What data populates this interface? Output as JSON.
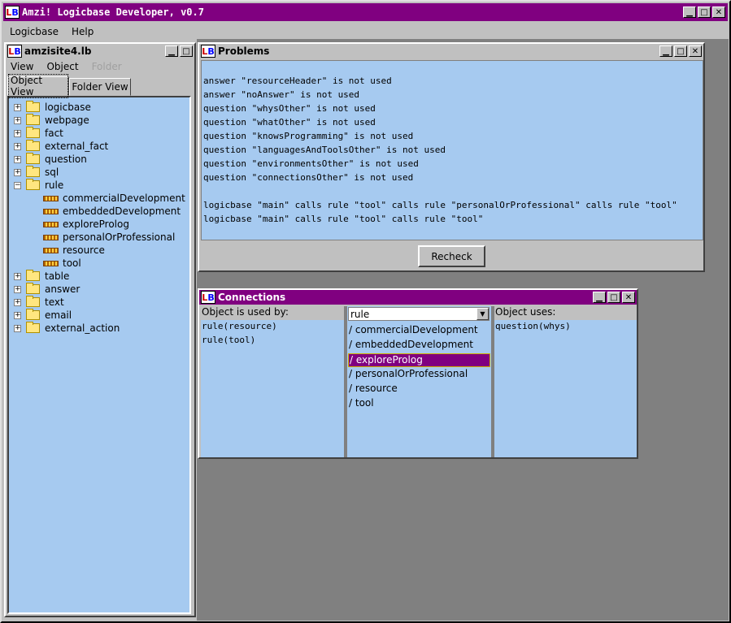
{
  "app": {
    "title": "Amzi! Logicbase Developer, v0.7",
    "menu": [
      "Logicbase",
      "Help"
    ]
  },
  "tree_window": {
    "title": "amzisite4.lb",
    "menu": [
      "View",
      "Object",
      "Folder"
    ],
    "tabs": [
      "Object View",
      "Folder View"
    ],
    "items": [
      {
        "label": "logicbase",
        "kind": "folder"
      },
      {
        "label": "webpage",
        "kind": "folder"
      },
      {
        "label": "fact",
        "kind": "folder"
      },
      {
        "label": "external_fact",
        "kind": "folder"
      },
      {
        "label": "question",
        "kind": "folder"
      },
      {
        "label": "sql",
        "kind": "folder"
      },
      {
        "label": "rule",
        "kind": "folder-open"
      },
      {
        "label": "commercialDevelopment",
        "kind": "rule"
      },
      {
        "label": "embeddedDevelopment",
        "kind": "rule"
      },
      {
        "label": "exploreProlog",
        "kind": "rule"
      },
      {
        "label": "personalOrProfessional",
        "kind": "rule"
      },
      {
        "label": "resource",
        "kind": "rule"
      },
      {
        "label": "tool",
        "kind": "rule"
      },
      {
        "label": "table",
        "kind": "folder"
      },
      {
        "label": "answer",
        "kind": "folder"
      },
      {
        "label": "text",
        "kind": "folder"
      },
      {
        "label": "email",
        "kind": "folder"
      },
      {
        "label": "external_action",
        "kind": "folder"
      }
    ]
  },
  "problems": {
    "title": "Problems",
    "lines": [
      "answer \"resourceHeader\" is not used",
      "answer \"noAnswer\" is not used",
      "question \"whysOther\" is not used",
      "question \"whatOther\" is not used",
      "question \"knowsProgramming\" is not used",
      "question \"languagesAndToolsOther\" is not used",
      "question \"environmentsOther\" is not used",
      "question \"connectionsOther\" is not used",
      "",
      "logicbase \"main\" calls rule \"tool\" calls rule \"personalOrProfessional\" calls rule \"tool\"",
      "logicbase \"main\" calls rule \"tool\" calls rule \"tool\""
    ],
    "recheck_label": "Recheck"
  },
  "connections": {
    "title": "Connections",
    "used_by_label": "Object is used by:",
    "used_by": [
      "rule(resource)",
      "rule(tool)"
    ],
    "type_select": "rule",
    "objects": [
      "/ commercialDevelopment",
      "/ embeddedDevelopment",
      "/ exploreProlog",
      "/ personalOrProfessional",
      "/ resource",
      "/ tool"
    ],
    "selected_index": 2,
    "uses_label": "Object uses:",
    "uses": [
      "question(whys)"
    ]
  },
  "colors": {
    "title_bar": "#800080",
    "panel": "#a6caf0",
    "desktop": "#808080",
    "selection": "#800080"
  }
}
